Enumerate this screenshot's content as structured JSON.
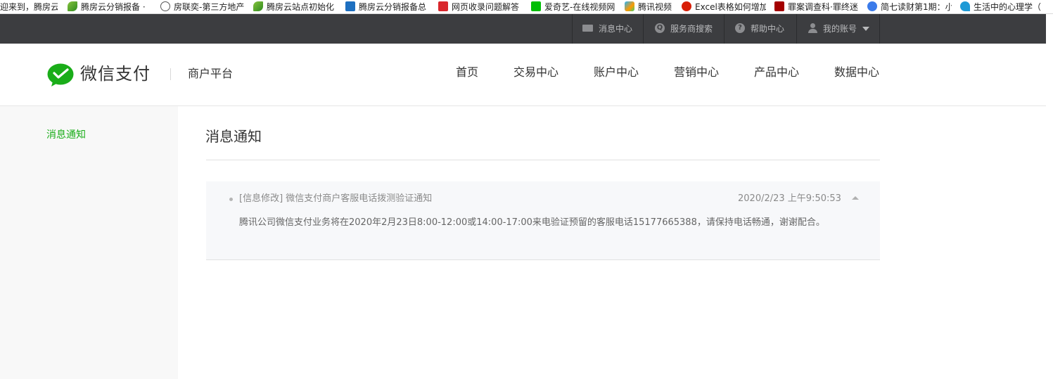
{
  "bookmarks": [
    {
      "label": "迎来到，腾房云",
      "icon": "none"
    },
    {
      "label": "腾房云分销报备 · ",
      "icon": "leaf-icon"
    },
    {
      "label": "房联奕-第三方地产",
      "icon": "globe-icon"
    },
    {
      "label": "腾房云站点初始化",
      "icon": "leaf-icon"
    },
    {
      "label": "腾房云分销报备总",
      "icon": "blue-doc-icon"
    },
    {
      "label": "网页收录问题解答",
      "icon": "red-c-icon"
    },
    {
      "label": "爱奇艺-在线视频网",
      "icon": "iqiyi-icon"
    },
    {
      "label": "腾讯视频",
      "icon": "tencent-video-icon"
    },
    {
      "label": "Excel表格如何增加",
      "icon": "php-icon"
    },
    {
      "label": "罪案调查科·罪终迷",
      "icon": "darkred-icon"
    },
    {
      "label": "简七读财第1期：小",
      "icon": "paw-icon"
    },
    {
      "label": "生活中的心理学（",
      "icon": "bird-icon"
    }
  ],
  "topbar": {
    "messages": "消息中心",
    "provider_search": "服务商搜索",
    "help": "帮助中心",
    "account": "我的账号"
  },
  "header": {
    "logo_text": "微信支付",
    "platform": "商户平台",
    "nav": [
      "首页",
      "交易中心",
      "账户中心",
      "营销中心",
      "产品中心",
      "数据中心"
    ]
  },
  "sidebar": {
    "items": [
      "消息通知"
    ],
    "active_color": "#1aad19"
  },
  "main": {
    "title": "消息通知",
    "notices": [
      {
        "title": "[信息修改]  微信支付商户客服电话拨测验证通知",
        "time": "2020/2/23 上午9:50:53",
        "body": "腾讯公司微信支付业务将在2020年2月23日8:00-12:00或14:00-17:00来电验证预留的客服电话15177665388，请保持电话畅通，谢谢配合。",
        "expanded": true
      }
    ]
  },
  "colors": {
    "topbar_bg": "#3c3d40",
    "brand_green": "#1aad19"
  }
}
